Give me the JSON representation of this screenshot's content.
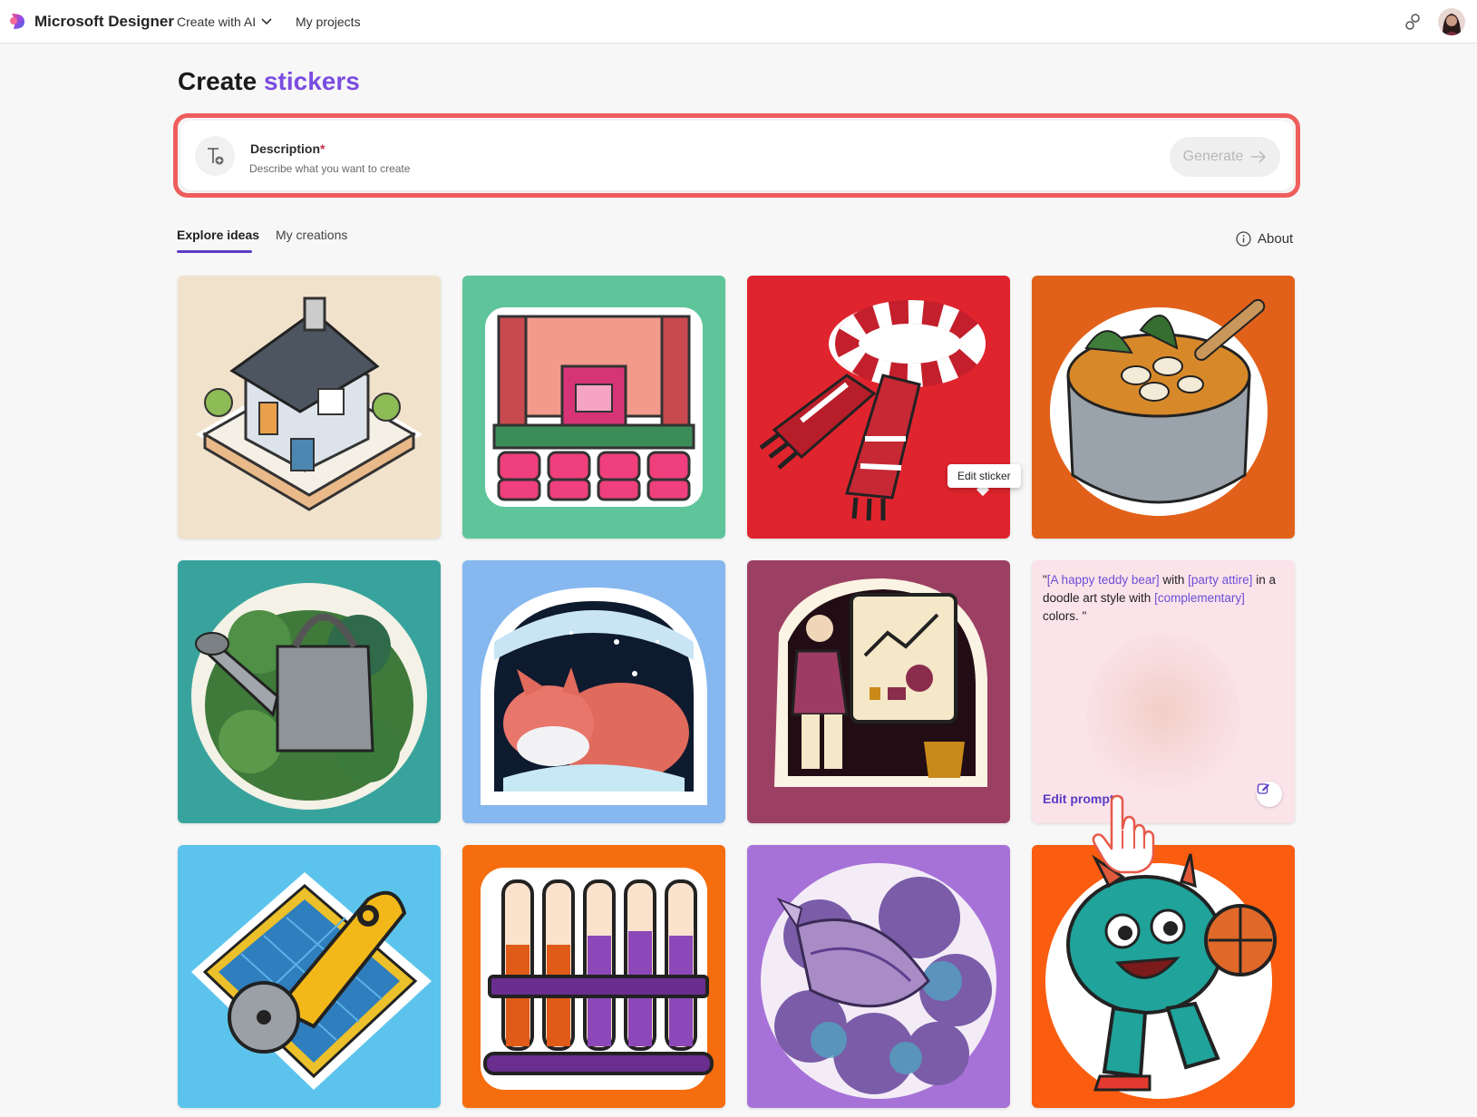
{
  "app": {
    "brand": "Microsoft Designer",
    "nav_create": "Create with AI",
    "nav_projects": "My projects"
  },
  "page": {
    "title_plain": "Create",
    "title_accent": "stickers"
  },
  "description": {
    "label": "Description",
    "required_mark": "*",
    "placeholder": "Describe what you want to create",
    "generate_label": "Generate"
  },
  "tabs": {
    "explore": "Explore ideas",
    "creations": "My creations",
    "about": "About"
  },
  "tooltip": {
    "text": "Edit sticker"
  },
  "prompt_card": {
    "quote_open": "\"",
    "part1": "[A happy teddy bear]",
    "part2": " with ",
    "part3": "[party attire]",
    "part4": " in a doodle art style with ",
    "part5": "[complementary]",
    "part6": " colors. \"",
    "edit_label": "Edit prompt"
  },
  "colors": {
    "accent": "#7b4ce0",
    "tab_underline": "#5b3cc4",
    "highlight": "#ef5d5d"
  },
  "tiles": [
    {
      "name": "house",
      "bg": "#f1e2cc"
    },
    {
      "name": "theater",
      "bg": "#5ec59a"
    },
    {
      "name": "scarf",
      "bg": "#e0242e"
    },
    {
      "name": "stew-pot",
      "bg": "#e2611a"
    },
    {
      "name": "watering-can",
      "bg": "#38a39c"
    },
    {
      "name": "sleeping-fox",
      "bg": "#86b7ef"
    },
    {
      "name": "presentation",
      "bg": "#9c4063"
    },
    {
      "name": "teddy-prompt",
      "bg": "#fbe3ea"
    },
    {
      "name": "rotary-cutter",
      "bg": "#5cc4ec"
    },
    {
      "name": "test-tubes",
      "bg": "#f66d0f"
    },
    {
      "name": "seashell",
      "bg": "#a772d8"
    },
    {
      "name": "monster",
      "bg": "#fa5d0f"
    }
  ]
}
